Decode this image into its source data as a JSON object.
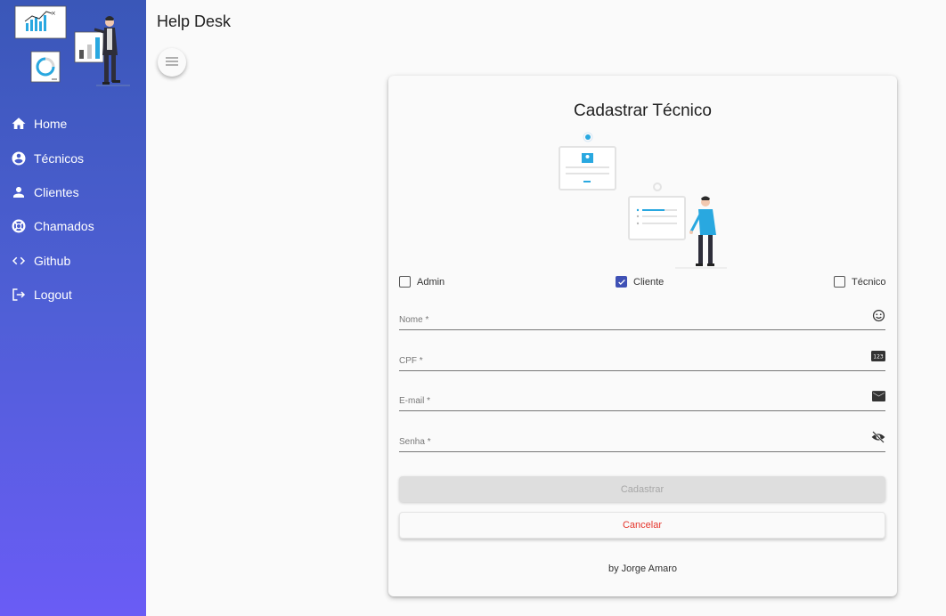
{
  "app": {
    "title": "Help Desk"
  },
  "sidebar": {
    "items": [
      {
        "label": "Home",
        "icon": "home-icon"
      },
      {
        "label": "Técnicos",
        "icon": "account-circle-icon"
      },
      {
        "label": "Clientes",
        "icon": "person-icon"
      },
      {
        "label": "Chamados",
        "icon": "lifebuoy-icon"
      },
      {
        "label": "Github",
        "icon": "code-icon"
      },
      {
        "label": "Logout",
        "icon": "logout-icon"
      }
    ],
    "gradient_top": "#3a57b8",
    "gradient_bottom": "#6a5cf5"
  },
  "form": {
    "title": "Cadastrar Técnico",
    "profiles": [
      {
        "label": "Admin",
        "checked": false
      },
      {
        "label": "Cliente",
        "checked": true
      },
      {
        "label": "Técnico",
        "checked": false
      }
    ],
    "fields": {
      "nome": {
        "label": "Nome *",
        "icon": "smiley-icon"
      },
      "cpf": {
        "label": "CPF *",
        "icon": "pin-123-icon"
      },
      "email": {
        "label": "E-mail *",
        "icon": "mail-icon"
      },
      "senha": {
        "label": "Senha *",
        "icon": "visibility-off-icon"
      }
    },
    "submit_label": "Cadastrar",
    "cancel_label": "Cancelar",
    "footer": "by Jorge Amaro",
    "accent": "#3f51b5",
    "cancel_color": "#e5342a"
  }
}
